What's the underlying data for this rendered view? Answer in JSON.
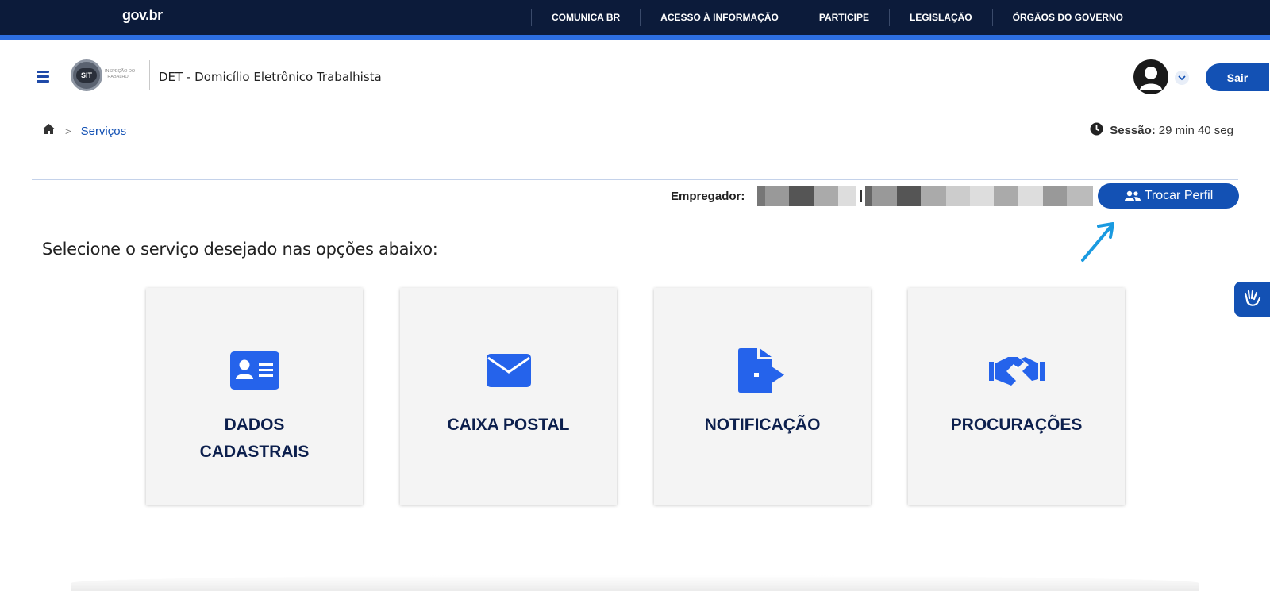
{
  "topbar": {
    "logo": "gov.br",
    "nav": [
      "COMUNICA BR",
      "ACESSO À INFORMAÇÃO",
      "PARTICIPE",
      "LEGISLAÇÃO",
      "ÓRGÃOS DO GOVERNO"
    ]
  },
  "header": {
    "sit_badge": "SIT",
    "sit_text": "INSPEÇÃO DO TRABALHO",
    "app_title": "DET - Domicílio Eletrônico Trabalhista",
    "logout_label": "Sair"
  },
  "breadcrumb": {
    "separator": ">",
    "current": "Serviços"
  },
  "session": {
    "label": "Sessão:",
    "remaining": "29 min 40 seg"
  },
  "employer": {
    "label": "Empregador:",
    "switch_profile_label": "Trocar Perfil"
  },
  "main": {
    "prompt": "Selecione o serviço desejado nas opções abaixo:",
    "cards": [
      {
        "label": "DADOS CADASTRAIS",
        "icon": "id-card-icon"
      },
      {
        "label": "CAIXA POSTAL",
        "icon": "envelope-icon"
      },
      {
        "label": "NOTIFICAÇÃO",
        "icon": "file-export-icon"
      },
      {
        "label": "PROCURAÇÕES",
        "icon": "handshake-icon"
      }
    ]
  },
  "colors": {
    "topbar": "#0c1b3a",
    "primary": "#1351b4",
    "card_text": "#0c1f4d",
    "card_bg": "#f4f4f4",
    "icon": "#2563eb"
  }
}
